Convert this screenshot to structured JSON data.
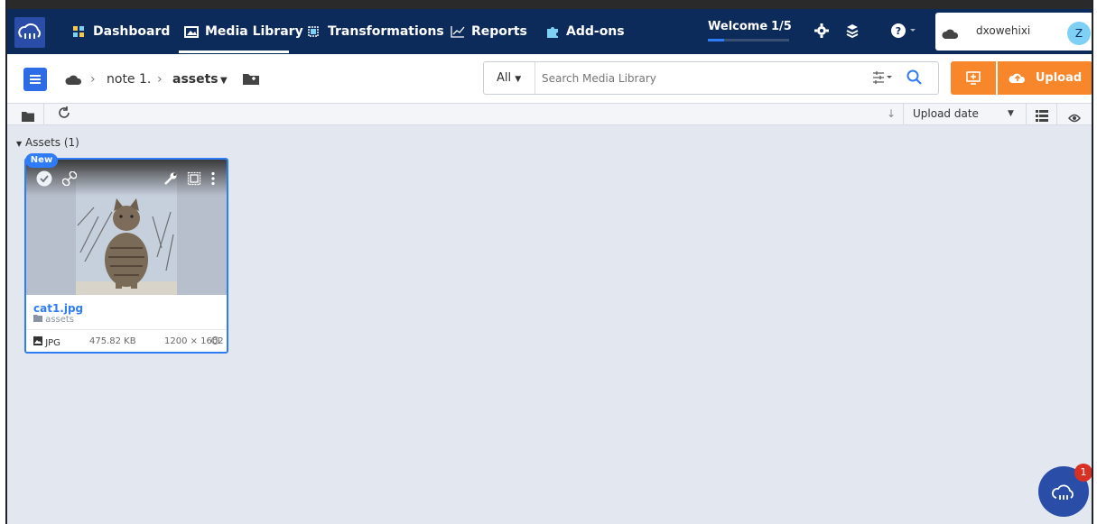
{
  "nav": {
    "items": [
      {
        "label": "Dashboard"
      },
      {
        "label": "Media Library"
      },
      {
        "label": "Transformations"
      },
      {
        "label": "Reports"
      },
      {
        "label": "Add-ons"
      }
    ],
    "welcome_label": "Welcome",
    "welcome_count": "1/5",
    "welcome_progress": 0.2,
    "user_name": "dxowehixi",
    "avatar_initial": "Z"
  },
  "breadcrumb": {
    "items": [
      "note 1.",
      "assets"
    ]
  },
  "search": {
    "scope": "All",
    "placeholder": "Search Media Library"
  },
  "upload_button": "Upload",
  "sort": {
    "label": "Upload date"
  },
  "assets": {
    "section_label": "Assets (1)",
    "items": [
      {
        "badge": "New",
        "name": "cat1.jpg",
        "folder": "assets",
        "type": "JPG",
        "size": "475.82 KB",
        "dimensions": "1200 × 1602"
      }
    ]
  },
  "chat": {
    "badge_count": "1"
  },
  "colors": {
    "nav_bg": "#0c2a5a",
    "accent_blue": "#2f7cf7",
    "upload_orange": "#f8862a",
    "canvas_bg": "#e3e8f0"
  }
}
